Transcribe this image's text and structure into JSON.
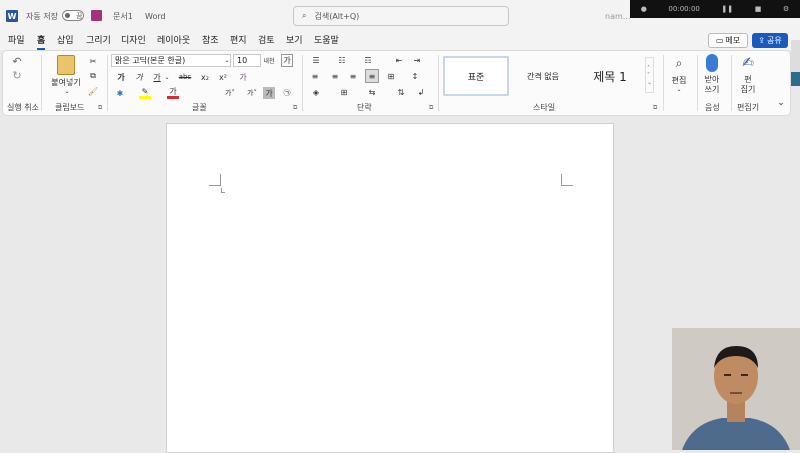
{
  "titlebar": {
    "autosave_label": "자동 저장",
    "toggle_state": "끔",
    "doc_name": "문서1",
    "app_name": "Word",
    "search_placeholder": "검색(Alt+Q)",
    "user_name": "nam...",
    "recording_time": "00:00:00"
  },
  "menu": {
    "items": [
      "파일",
      "홈",
      "삽입",
      "그리기",
      "디자인",
      "레이아웃",
      "참조",
      "편지",
      "검토",
      "보기",
      "도움말"
    ],
    "active": "홈",
    "memo_label": "메모",
    "share_label": "공유"
  },
  "ribbon": {
    "undo_group": "실행 취소",
    "clipboard": {
      "label": "클립보드",
      "paste": "붙여넣기"
    },
    "font": {
      "label": "글꼴",
      "family": "맑은 고딕(본문 한글)",
      "size": "10",
      "bold": "가",
      "italic": "가",
      "underline": "가",
      "strike": "abc",
      "subscript": "x₂",
      "superscript": "x²",
      "grow": "가˄",
      "shrink": "가˅",
      "clear": "가",
      "phonetic": "내천",
      "border": "가",
      "char_shade": "가",
      "circle": "㉠"
    },
    "paragraph": {
      "label": "단락"
    },
    "styles": {
      "label": "스타일",
      "items": [
        "표준",
        "간격 없음",
        "제목 1"
      ]
    },
    "editing": {
      "label": "편집"
    },
    "voice": {
      "group": "음성",
      "button": "받아\n쓰기"
    },
    "editor": {
      "group": "편집기",
      "button": "편\n집기"
    }
  },
  "colors": {
    "accent": "#185abd",
    "word_blue": "#2b579a",
    "highlight_yellow": "#ffff00",
    "font_red": "#d32f2f"
  }
}
